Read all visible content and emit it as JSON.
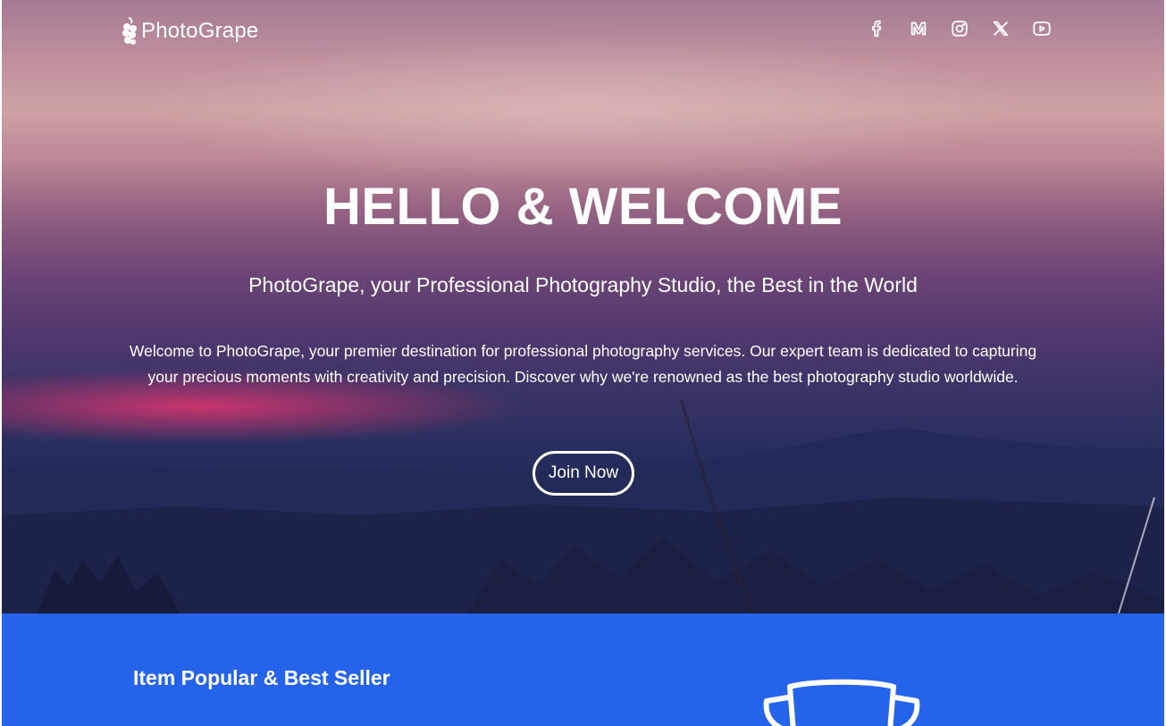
{
  "brand": {
    "name": "PhotoGrape"
  },
  "social_icons": [
    {
      "name": "facebook-icon"
    },
    {
      "name": "medium-icon"
    },
    {
      "name": "instagram-icon"
    },
    {
      "name": "x-icon"
    },
    {
      "name": "youtube-icon"
    }
  ],
  "hero": {
    "title": "HELLO & WELCOME",
    "subtitle": "PhotoGrape, your Professional Photography Studio, the Best in the World",
    "description": "Welcome to PhotoGrape, your premier destination for professional photography services. Our expert team is dedicated to capturing your precious moments with creativity and precision. Discover why we're renowned as the best photography studio worldwide.",
    "cta_label": "Join Now"
  },
  "popular": {
    "title": "Item Popular & Best Seller",
    "icon": "trophy-icon"
  },
  "colors": {
    "accent_blue": "#2563eb",
    "text_light": "#ffffff"
  }
}
